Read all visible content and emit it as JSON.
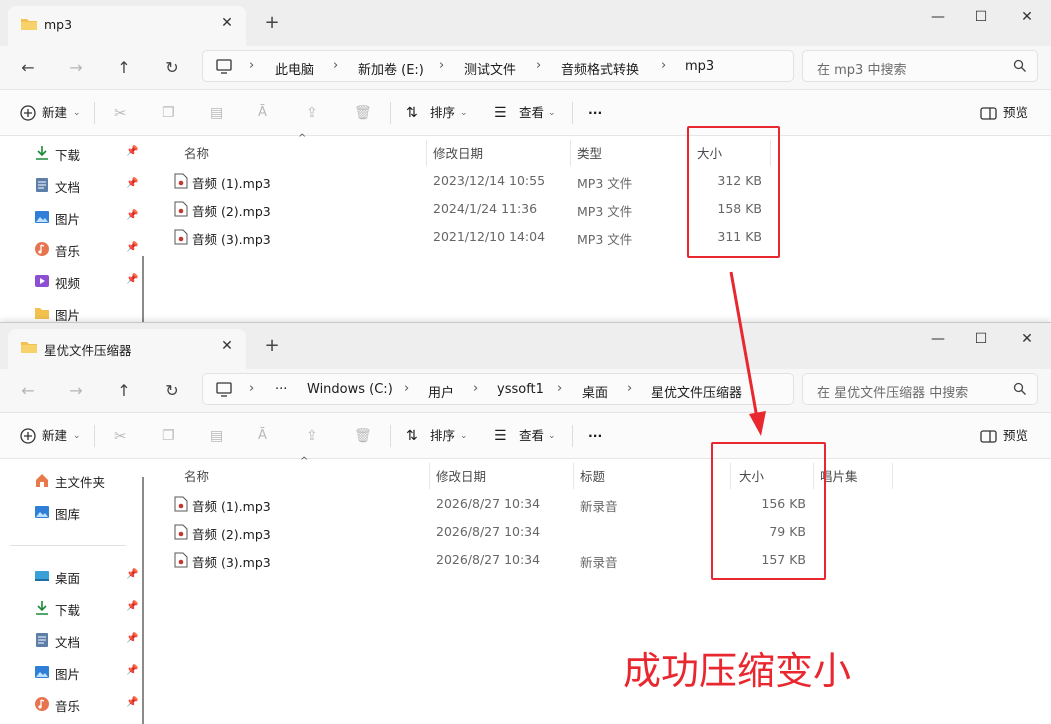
{
  "annotation": {
    "text": "成功压缩变小",
    "color": "#e8272f"
  },
  "window1": {
    "tab_title": "mp3",
    "address": [
      "此电脑",
      "新加卷 (E:)",
      "测试文件",
      "音频格式转换",
      "mp3"
    ],
    "search_placeholder": "在 mp3 中搜索",
    "toolbar": {
      "new": "新建",
      "sort": "排序",
      "view": "查看",
      "more": "···",
      "preview": "预览"
    },
    "sidebar": [
      {
        "label": "下载",
        "icon": "download-icon"
      },
      {
        "label": "文档",
        "icon": "document-icon"
      },
      {
        "label": "图片",
        "icon": "pictures-icon"
      },
      {
        "label": "音乐",
        "icon": "music-icon"
      },
      {
        "label": "视频",
        "icon": "video-icon"
      },
      {
        "label": "图片",
        "icon": "folder-icon"
      }
    ],
    "columns": {
      "name": "名称",
      "modified": "修改日期",
      "type": "类型",
      "size": "大小"
    },
    "files": [
      {
        "name": "音频 (1).mp3",
        "modified": "2023/12/14 10:55",
        "type": "MP3 文件",
        "size": "312 KB"
      },
      {
        "name": "音频 (2).mp3",
        "modified": "2024/1/24 11:36",
        "type": "MP3 文件",
        "size": "158 KB"
      },
      {
        "name": "音频 (3).mp3",
        "modified": "2021/12/10 14:04",
        "type": "MP3 文件",
        "size": "311 KB"
      }
    ]
  },
  "window2": {
    "tab_title": "星优文件压缩器",
    "address": [
      "···",
      "Windows (C:)",
      "用户",
      "yssoft1",
      "桌面",
      "星优文件压缩器"
    ],
    "search_placeholder": "在 星优文件压缩器 中搜索",
    "toolbar": {
      "new": "新建",
      "sort": "排序",
      "view": "查看",
      "more": "···",
      "preview": "预览"
    },
    "sidebar_top": [
      {
        "label": "主文件夹",
        "icon": "home-icon"
      },
      {
        "label": "图库",
        "icon": "gallery-icon"
      }
    ],
    "sidebar": [
      {
        "label": "桌面",
        "icon": "desktop-icon"
      },
      {
        "label": "下载",
        "icon": "download-icon"
      },
      {
        "label": "文档",
        "icon": "document-icon"
      },
      {
        "label": "图片",
        "icon": "pictures-icon"
      },
      {
        "label": "音乐",
        "icon": "music-icon"
      }
    ],
    "columns": {
      "name": "名称",
      "modified": "修改日期",
      "title": "标题",
      "size": "大小",
      "album": "唱片集"
    },
    "files": [
      {
        "name": "音频 (1).mp3",
        "modified": "2026/8/27 10:34",
        "title": "新录音",
        "size": "156 KB"
      },
      {
        "name": "音频 (2).mp3",
        "modified": "2026/8/27 10:34",
        "title": "",
        "size": "79 KB"
      },
      {
        "name": "音频 (3).mp3",
        "modified": "2026/8/27 10:34",
        "title": "新录音",
        "size": "157 KB"
      }
    ]
  }
}
